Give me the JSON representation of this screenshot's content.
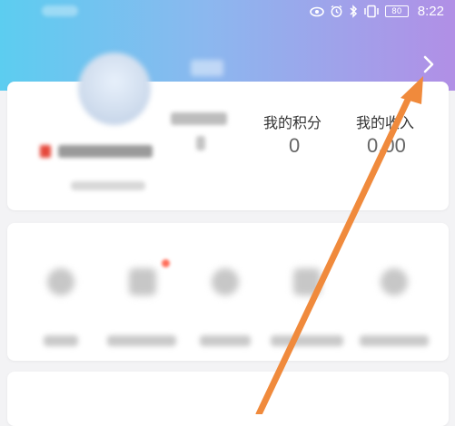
{
  "status_bar": {
    "time": "8:22",
    "battery": "80",
    "icons": [
      "eye-icon",
      "alarm-icon",
      "bluetooth-icon",
      "vibrate-icon",
      "battery-icon"
    ]
  },
  "header": {
    "gradient_colors": [
      "#5ccdf0",
      "#b18fe6"
    ],
    "chevron_icon": "chevron-right-icon"
  },
  "profile": {
    "stats": [
      {
        "label": "",
        "value": ""
      },
      {
        "label": "我的积分",
        "value": "0"
      },
      {
        "label": "我的收入",
        "value": "0.00"
      }
    ]
  },
  "annotation": {
    "arrow_color": "#f08a3c"
  }
}
